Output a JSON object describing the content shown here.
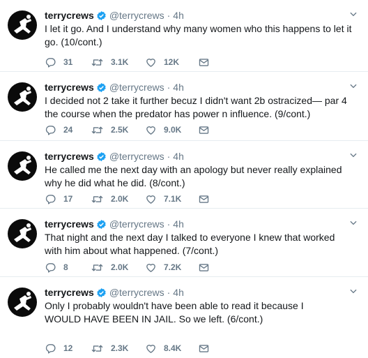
{
  "accent": "#1da1f2",
  "muted": "#657786",
  "tweets": [
    {
      "name": "terrycrews",
      "handle": "@terrycrews",
      "time": "4h",
      "text": "I let it go. And I understand why many women who this happens to let it go. (10/cont.)",
      "replies": "31",
      "retweets": "3.1K",
      "likes": "12K"
    },
    {
      "name": "terrycrews",
      "handle": "@terrycrews",
      "time": "4h",
      "text": "I decided not 2 take it further becuz I didn't want 2b ostracized— par 4 the course when the predator has power n influence. (9/cont.)",
      "replies": "24",
      "retweets": "2.5K",
      "likes": "9.0K"
    },
    {
      "name": "terrycrews",
      "handle": "@terrycrews",
      "time": "4h",
      "text": "He called me the next day with an apology but never really explained why he did what he did. (8/cont.)",
      "replies": "17",
      "retweets": "2.0K",
      "likes": "7.1K"
    },
    {
      "name": "terrycrews",
      "handle": "@terrycrews",
      "time": "4h",
      "text": "That night and the next day I talked to everyone I knew that worked with him about what happened. (7/cont.)",
      "replies": "8",
      "retweets": "2.0K",
      "likes": "7.2K"
    },
    {
      "name": "terrycrews",
      "handle": "@terrycrews",
      "time": "4h",
      "text": "Only I probably wouldn't have been able to read it because I WOULD HAVE BEEN IN JAIL. So we left. (6/cont.)",
      "replies": "12",
      "retweets": "2.3K",
      "likes": "8.4K"
    }
  ]
}
